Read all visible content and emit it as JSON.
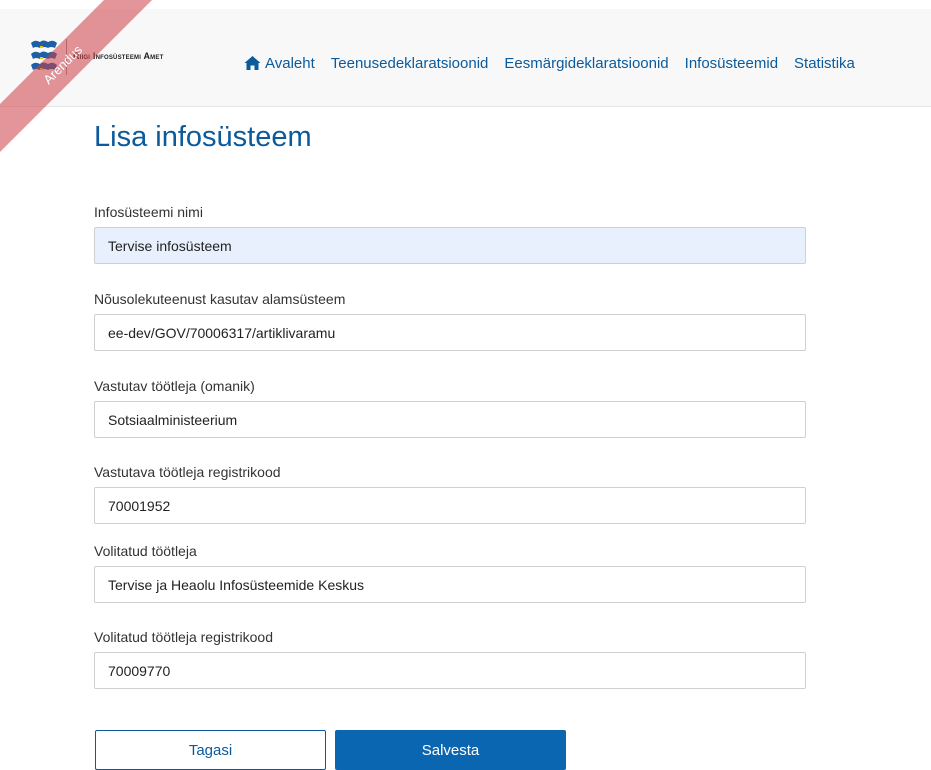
{
  "header": {
    "org_name": "Riigi Infosüsteemi Amet",
    "env_ribbon": "Arendus",
    "nav": [
      {
        "label": "Avaleht",
        "icon": "home-icon"
      },
      {
        "label": "Teenusedeklaratsioonid"
      },
      {
        "label": "Eesmärgideklaratsioonid"
      },
      {
        "label": "Infosüsteemid"
      },
      {
        "label": "Statistika"
      }
    ]
  },
  "page": {
    "title": "Lisa infosüsteem"
  },
  "form": {
    "fields": [
      {
        "label": "Infosüsteemi nimi",
        "value": "Tervise infosüsteem"
      },
      {
        "label": "Nõusolekuteenust kasutav alamsüsteem",
        "value": "ee-dev/GOV/70006317/artiklivaramu"
      },
      {
        "label": "Vastutav töötleja (omanik)",
        "value": "Sotsiaalministeerium"
      },
      {
        "label": "Vastutava töötleja registrikood",
        "value": "70001952"
      },
      {
        "label": "Volitatud töötleja",
        "value": "Tervise ja Heaolu Infosüsteemide Keskus"
      },
      {
        "label": "Volitatud töötleja registrikood",
        "value": "70009770"
      }
    ],
    "back_label": "Tagasi",
    "save_label": "Salvesta"
  },
  "colors": {
    "accent": "#0b5a9c",
    "primary_button": "#0b66b2",
    "ribbon": "#cc3e46",
    "autofill_bg": "#e8f0fe"
  }
}
